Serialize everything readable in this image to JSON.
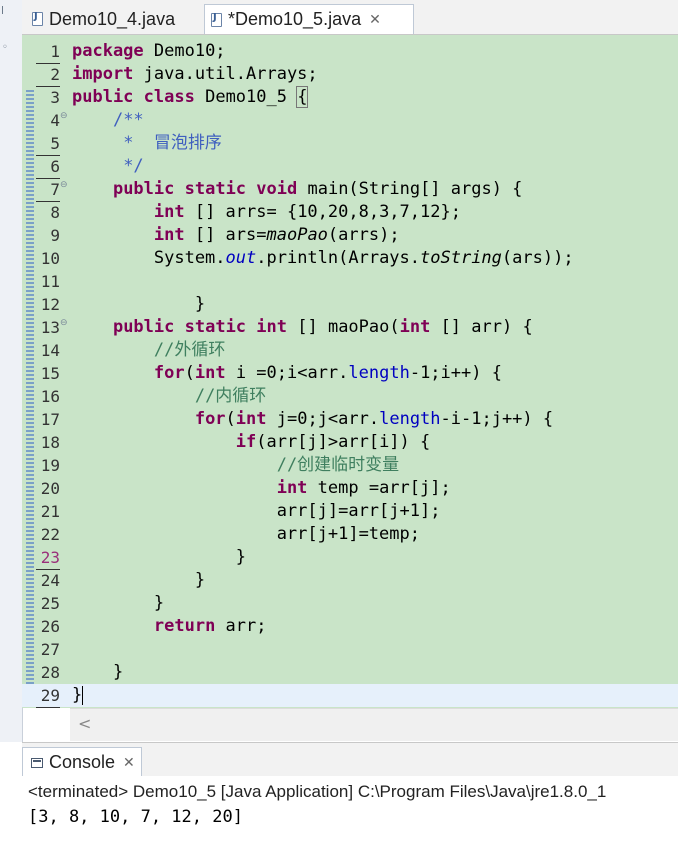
{
  "tabs": [
    {
      "label": "Demo10_4.java",
      "icon": "java-file-icon",
      "active": false
    },
    {
      "label": "*Demo10_5.java",
      "icon": "java-file-icon",
      "active": true,
      "close": "✕"
    }
  ],
  "editor": {
    "lines": [
      {
        "n": "1",
        "html": "<span class=\"kw\">package</span> Demo10;"
      },
      {
        "n": "2",
        "html": "<span class=\"kw\">import</span> java.util.Arrays;"
      },
      {
        "n": "3",
        "html": "<span class=\"kw\">public</span> <span class=\"kw\">class</span> Demo10_5 <span class=\"bracket\">{</span>"
      },
      {
        "n": "4",
        "fold": true,
        "html": "    <span class=\"jd\">/**</span>"
      },
      {
        "n": "5",
        "html": "    <span class=\"jd\"> *  冒泡排序</span>"
      },
      {
        "n": "6",
        "html": "    <span class=\"jd\"> */</span>"
      },
      {
        "n": "7",
        "fold": true,
        "html": "    <span class=\"kw\">public</span> <span class=\"kw\">static</span> <span class=\"kw\">void</span> main(String[] args) {"
      },
      {
        "n": "8",
        "html": "        <span class=\"kw\">int</span> [] arrs= {10,20,8,3,7,12};"
      },
      {
        "n": "9",
        "html": "        <span class=\"kw\">int</span> [] ars=<span class=\"it\">maoPao</span>(arrs);"
      },
      {
        "n": "10",
        "html": "        System.<span class=\"fld it\">out</span>.println(Arrays.<span class=\"it\">toString</span>(ars));"
      },
      {
        "n": "11",
        "html": ""
      },
      {
        "n": "12",
        "html": "            }"
      },
      {
        "n": "13",
        "fold": true,
        "html": "    <span class=\"kw\">public</span> <span class=\"kw\">static</span> <span class=\"kw\">int</span> [] maoPao(<span class=\"kw\">int</span> [] arr) {"
      },
      {
        "n": "14",
        "html": "        <span class=\"cmt\">//外循环</span>"
      },
      {
        "n": "15",
        "html": "        <span class=\"kw\">for</span>(<span class=\"kw\">int</span> i =0;i&lt;arr.<span class=\"fld\">length</span>-1;i++) {"
      },
      {
        "n": "16",
        "html": "            <span class=\"cmt\">//内循环</span>"
      },
      {
        "n": "17",
        "html": "            <span class=\"kw\">for</span>(<span class=\"kw\">int</span> j=0;j&lt;arr.<span class=\"fld\">length</span>-i-1;j++) {"
      },
      {
        "n": "18",
        "html": "                <span class=\"kw\">if</span>(arr[j]&gt;arr[i]) {"
      },
      {
        "n": "19",
        "html": "                    <span class=\"cmt\">//创建临时变量</span>"
      },
      {
        "n": "20",
        "html": "                    <span class=\"kw\">int</span> temp =arr[j];"
      },
      {
        "n": "21",
        "html": "                    arr[j]=arr[j+1];"
      },
      {
        "n": "22",
        "html": "                    arr[j+1]=temp;"
      },
      {
        "n": "23",
        "edited": true,
        "html": "                }"
      },
      {
        "n": "24",
        "html": "            }"
      },
      {
        "n": "25",
        "html": "        }"
      },
      {
        "n": "26",
        "html": "        <span class=\"kw\">return</span> arr;"
      },
      {
        "n": "27",
        "html": ""
      },
      {
        "n": "28",
        "html": "    }"
      },
      {
        "n": "29",
        "current": true,
        "html": "}<span class=\"caret\"></span>"
      }
    ]
  },
  "scrollbar": {
    "left_arrow": "<"
  },
  "console": {
    "tab_label": "Console",
    "close": "✕",
    "status": "<terminated> Demo10_5 [Java Application] C:\\Program Files\\Java\\jre1.8.0_1",
    "output": "[3, 8, 10, 7, 12, 20]"
  }
}
